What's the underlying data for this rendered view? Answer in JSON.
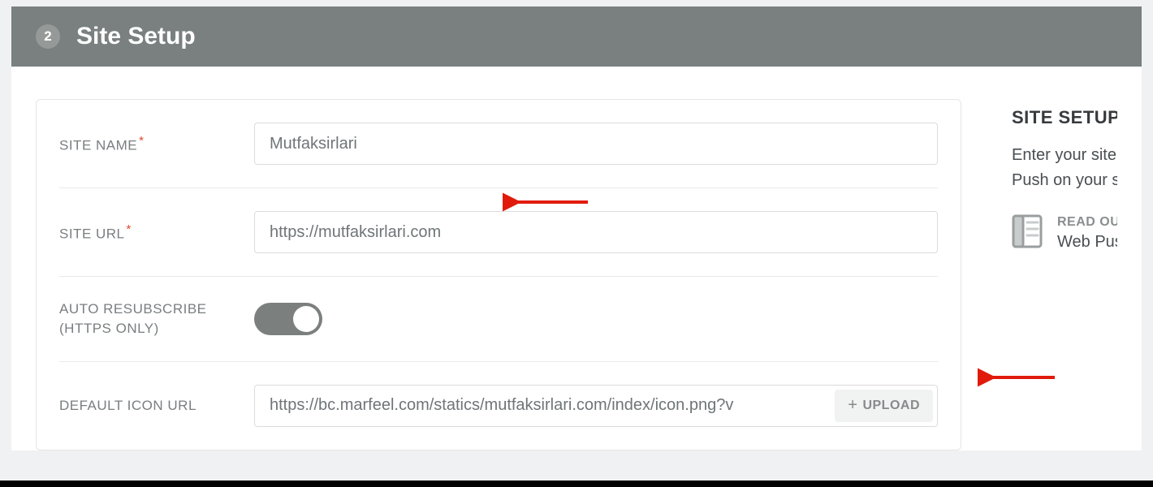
{
  "header": {
    "step_number": "2",
    "title": "Site Setup"
  },
  "form": {
    "site_name": {
      "label": "SITE NAME",
      "value": "Mutfaksirlari",
      "required": true
    },
    "site_url": {
      "label": "SITE URL",
      "value": "https://mutfaksirlari.com",
      "required": true
    },
    "auto_resubscribe": {
      "label_line1": "AUTO RESUBSCRIBE",
      "label_line2": "(HTTPS ONLY)"
    },
    "default_icon": {
      "label": "DEFAULT ICON URL",
      "value": "https://bc.marfeel.com/statics/mutfaksirlari.com/index/icon.png?v"
    },
    "upload_label": "UPLOAD"
  },
  "help": {
    "title": "SITE SETUP",
    "line1": "Enter your site",
    "line2": "Push on your s",
    "kb_title": "READ OU",
    "kb_sub": "Web Pus"
  }
}
